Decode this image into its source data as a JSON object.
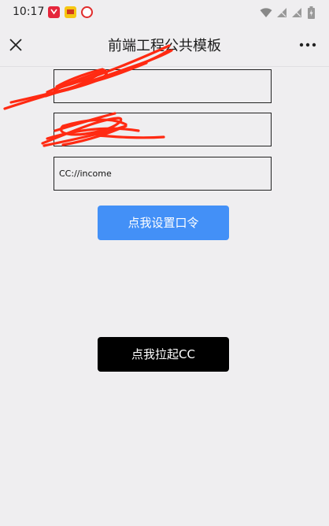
{
  "status_bar": {
    "time": "10:17",
    "app_icons": [
      "red-app-icon",
      "yellow-app-icon",
      "netease-music-icon"
    ],
    "system_icons": [
      "wifi-icon",
      "signal-icon",
      "signal-icon",
      "battery-icon"
    ]
  },
  "nav": {
    "title": "前端工程公共模板",
    "close_icon": "close-icon",
    "more_icon": "more-icon"
  },
  "form": {
    "field1_value": "",
    "field2_value": "",
    "field3_value": "CC://income"
  },
  "buttons": {
    "set_password_label": "点我设置口令",
    "launch_cc_label": "点我拉起CC"
  },
  "colors": {
    "primary": "#4390f7",
    "dark": "#000000",
    "background": "#efeef0",
    "redaction": "#ff2a12"
  }
}
